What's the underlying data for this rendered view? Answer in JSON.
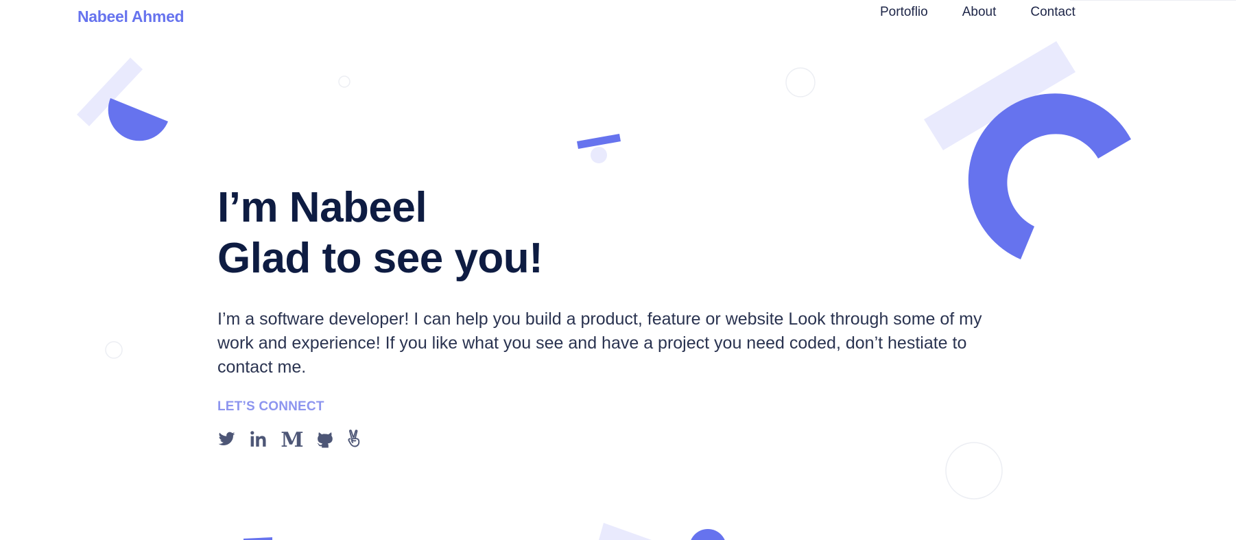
{
  "header": {
    "logo": "Nabeel Ahmed",
    "nav": [
      {
        "label": "Portoflio"
      },
      {
        "label": "About"
      },
      {
        "label": "Contact"
      }
    ]
  },
  "hero": {
    "title_line1": "I’m Nabeel",
    "title_line2": "Glad to see you!",
    "description": "I’m a software developer! I can help you build a product, feature or website Look through some of my work and experience! If you like what you see and have a project you need coded, don’t hestiate to contact me.",
    "connect_label": "LET’S CONNECT",
    "socials": [
      {
        "icon": "twitter-icon"
      },
      {
        "icon": "linkedin-icon"
      },
      {
        "icon": "medium-icon"
      },
      {
        "icon": "github-icon"
      },
      {
        "icon": "angellist-icon"
      }
    ]
  },
  "colors": {
    "accent": "#6673ee",
    "accent_light": "#e9eafd",
    "heading": "#0e1c42",
    "text": "#2a3350",
    "connect": "#8d95ef",
    "icon": "#4d5676"
  }
}
